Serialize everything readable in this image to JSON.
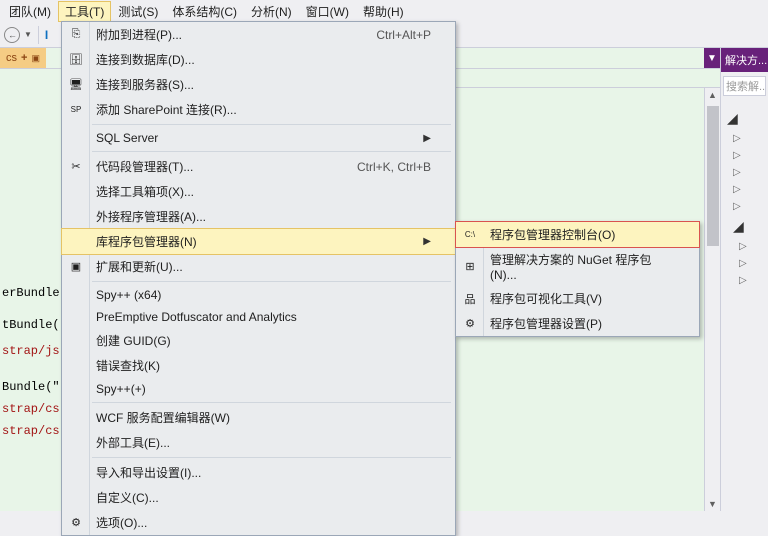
{
  "menubar": {
    "items": [
      "团队(M)",
      "工具(T)",
      "测试(S)",
      "体系结构(C)",
      "分析(N)",
      "窗口(W)",
      "帮助(H)"
    ],
    "open_index": 1
  },
  "doc_tab": {
    "label": "cs",
    "badge": "+"
  },
  "code_lines": {
    "l0": "erBundle(",
    "l1": "tBundle(",
    "l2": "strap/js",
    "l3": "Bundle(\"",
    "l4": "strap/cs",
    "l5": "strap/cs"
  },
  "tools_menu": {
    "items": [
      {
        "label": "附加到进程(P)...",
        "shortcut": "Ctrl+Alt+P",
        "icon": "plug"
      },
      {
        "label": "连接到数据库(D)...",
        "icon": "db"
      },
      {
        "label": "连接到服务器(S)...",
        "icon": "server"
      },
      {
        "label": "添加 SharePoint 连接(R)...",
        "icon": "sp"
      },
      {
        "sep": true
      },
      {
        "label": "SQL Server",
        "submenu": true
      },
      {
        "sep": true
      },
      {
        "label": "代码段管理器(T)...",
        "shortcut": "Ctrl+K, Ctrl+B",
        "icon": "snip"
      },
      {
        "label": "选择工具箱项(X)..."
      },
      {
        "label": "外接程序管理器(A)..."
      },
      {
        "label": "库程序包管理器(N)",
        "submenu": true,
        "highlighted": true
      },
      {
        "label": "扩展和更新(U)...",
        "icon": "ext"
      },
      {
        "sep": true
      },
      {
        "label": "Spy++ (x64)"
      },
      {
        "label": "PreEmptive Dotfuscator and Analytics"
      },
      {
        "label": "创建 GUID(G)"
      },
      {
        "label": "错误查找(K)"
      },
      {
        "label": "Spy++(+)"
      },
      {
        "sep": true
      },
      {
        "label": "WCF 服务配置编辑器(W)"
      },
      {
        "label": "外部工具(E)..."
      },
      {
        "sep": true
      },
      {
        "label": "导入和导出设置(I)..."
      },
      {
        "label": "自定义(C)..."
      },
      {
        "label": "选项(O)...",
        "icon": "gear"
      }
    ]
  },
  "nuget_submenu": {
    "items": [
      {
        "label": "程序包管理器控制台(O)",
        "icon": "cmd",
        "highlighted": true
      },
      {
        "label": "管理解决方案的 NuGet 程序包(N)...",
        "icon": "pkg"
      },
      {
        "label": "程序包可视化工具(V)",
        "icon": "viz"
      },
      {
        "label": "程序包管理器设置(P)",
        "icon": "gear"
      }
    ]
  },
  "right_panel": {
    "title": "解决方...",
    "search_placeholder": "搜索解..."
  }
}
